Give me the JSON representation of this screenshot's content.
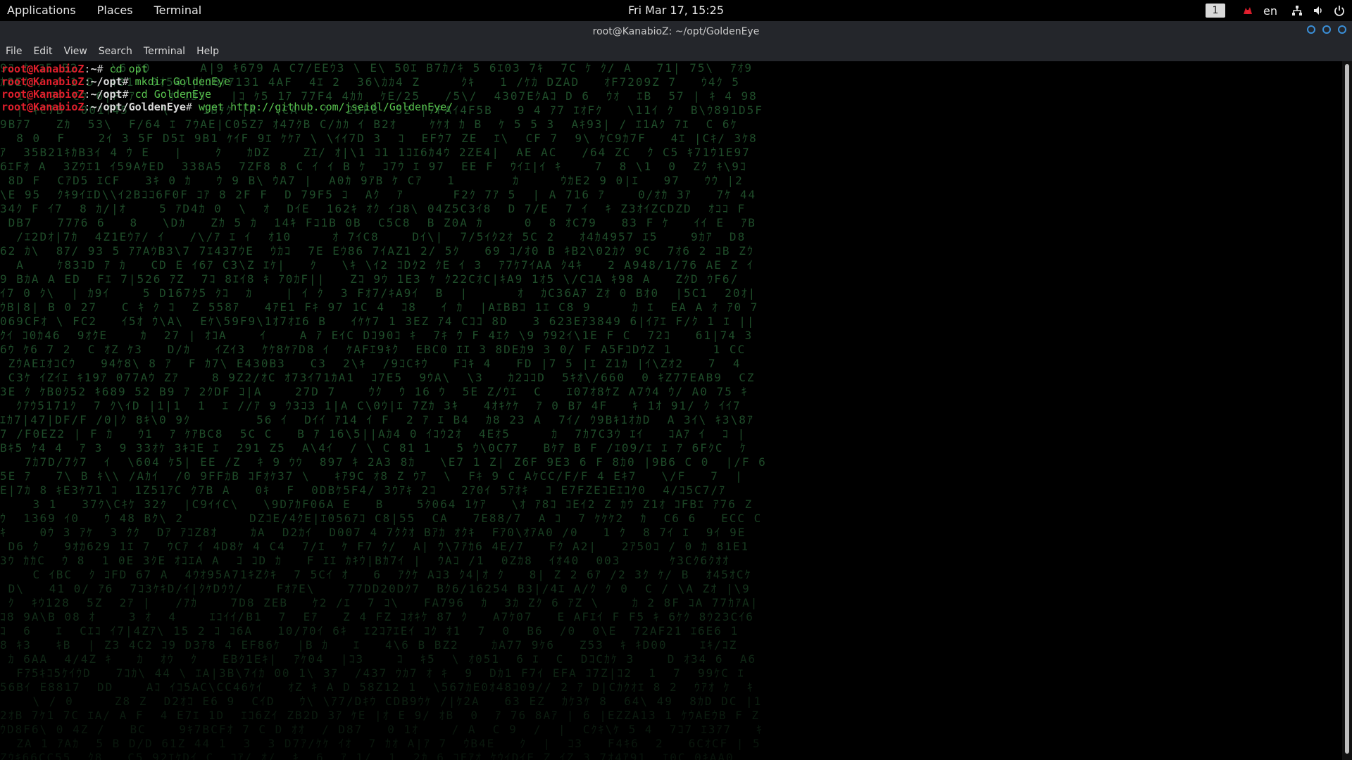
{
  "topbar": {
    "menus": [
      "Applications",
      "Places",
      "Terminal"
    ],
    "clock": "Fri Mar 17, 15:25",
    "workspace": "1",
    "language": "en",
    "icons": [
      "workspace-indicator",
      "app-indicator-icon",
      "network-icon",
      "volume-icon",
      "power-icon"
    ]
  },
  "window": {
    "title": "root@KanabioZ: ~/opt/GoldenEye",
    "menu": [
      "File",
      "Edit",
      "View",
      "Search",
      "Terminal",
      "Help"
    ]
  },
  "terminal": {
    "lines": [
      {
        "user": "root@KanabioZ",
        "colon": ":",
        "path": "~",
        "hash": "# ",
        "cmd": "cd opt"
      },
      {
        "user": "root@KanabioZ",
        "colon": ":",
        "path": "~/opt",
        "hash": "# ",
        "cmd": "mkdir GoldenEye"
      },
      {
        "user": "root@KanabioZ",
        "colon": ":",
        "path": "~/opt",
        "hash": "# ",
        "cmd": "cd GoldenEye"
      },
      {
        "user": "root@KanabioZ",
        "colon": ":",
        "path": "~/opt/GoldenEye",
        "hash": "# ",
        "cmd": "wget http://github.com/jseidl/GoldenEye/"
      }
    ]
  },
  "colors": {
    "prompt_user": "#e01f2c",
    "command": "#58c24e",
    "rain": "#1f4d2a",
    "window_chrome": "#24262b",
    "window_buttons": "#3a8fd8"
  }
}
